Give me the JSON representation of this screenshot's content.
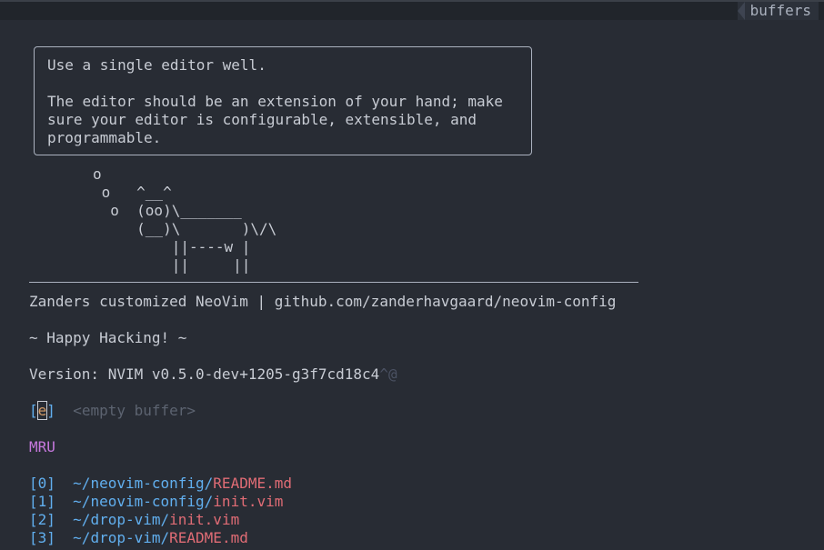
{
  "tabline": {
    "buffers_label": "buffers"
  },
  "quote": {
    "line1": "Use a single editor well.",
    "line2": "",
    "line3": "The editor should be an extension of your hand; make",
    "line4": "sure your editor is configurable, extensible, and",
    "line5": "programmable."
  },
  "cow": {
    "l1": "o",
    "l2": " o   ^__^",
    "l3": "  o  (oo)\\_______",
    "l4": "     (__)\\       )\\/\\",
    "l5": "         ||----w |",
    "l6": "         ||     ||"
  },
  "header": {
    "title": "Zanders customized NeoVim | github.com/zanderhavgaard/neovim-config",
    "greeting": "~ Happy Hacking! ~",
    "version": "Version: NVIM v0.5.0-dev+1205-g3f7cd18c4",
    "version_ctrl": "^@"
  },
  "empty_buffer": {
    "bracket_open": "[",
    "key": "e",
    "bracket_close": "]",
    "label": "<empty buffer>"
  },
  "mru": {
    "heading": "MRU",
    "items": [
      {
        "index": "[0]",
        "dir": "~/neovim-config/",
        "file": "README.md"
      },
      {
        "index": "[1]",
        "dir": "~/neovim-config/",
        "file": "init.vim"
      },
      {
        "index": "[2]",
        "dir": "~/drop-vim/",
        "file": "init.vim"
      },
      {
        "index": "[3]",
        "dir": "~/drop-vim/",
        "file": "README.md"
      }
    ]
  },
  "colors": {
    "background": "#282c34",
    "blue": "#61afef",
    "red": "#e06c75",
    "purple": "#c678dd",
    "orange": "#d19a66",
    "gray": "#5c6370"
  }
}
